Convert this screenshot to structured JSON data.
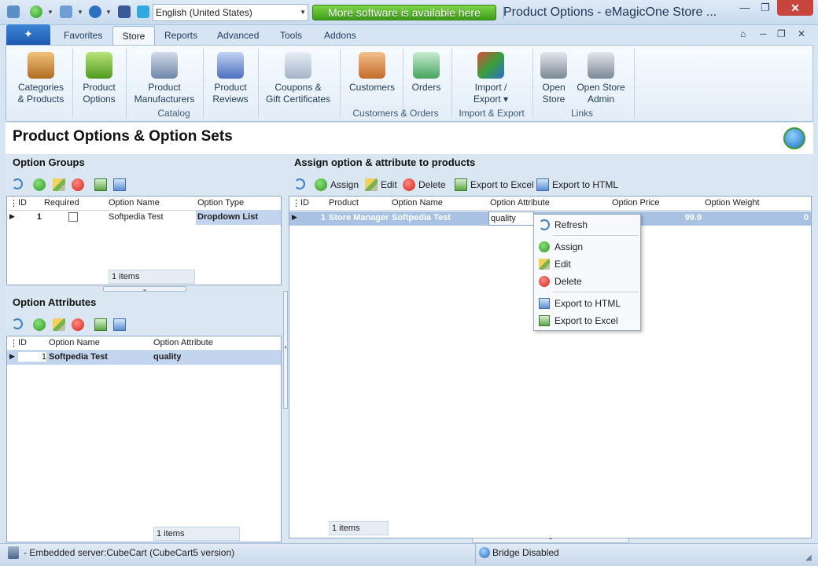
{
  "titlebar": {
    "language": "English (United States)",
    "promo": "More software is available here",
    "window_title": "Product Options - eMagicOne Store ...",
    "min": "—",
    "restore": "❐",
    "close": "✕"
  },
  "tabs": [
    {
      "label": "Favorites"
    },
    {
      "label": "Store"
    },
    {
      "label": "Reports"
    },
    {
      "label": "Advanced"
    },
    {
      "label": "Tools"
    },
    {
      "label": "Addons"
    }
  ],
  "ribbon": {
    "buttons": [
      {
        "label": "Categories\n& Products"
      },
      {
        "label": "Product\nOptions"
      },
      {
        "label": "Product\nManufacturers"
      },
      {
        "label": "Product\nReviews"
      },
      {
        "label": "Coupons &\nGift Certificates"
      },
      {
        "label": "Customers"
      },
      {
        "label": "Orders"
      },
      {
        "label": "Import /\nExport ▾"
      },
      {
        "label": "Open\nStore"
      },
      {
        "label": "Open Store\nAdmin"
      }
    ],
    "groups": [
      "Catalog",
      "Customers & Orders",
      "Import & Export",
      "Links"
    ]
  },
  "page": {
    "title": "Product Options & Option Sets"
  },
  "option_groups": {
    "title": "Option Groups",
    "columns": [
      "ID",
      "Required",
      "Option Name",
      "Option Type"
    ],
    "rows": [
      {
        "id": "1",
        "option_name": "Softpedia Test",
        "option_type": "Dropdown List"
      }
    ],
    "count": "1 items"
  },
  "option_attributes": {
    "title": "Option Attributes",
    "columns": [
      "ID",
      "Option Name",
      "Option Attribute"
    ],
    "rows": [
      {
        "id": "1",
        "option_name": "Softpedia Test",
        "option_attribute": "quality"
      }
    ],
    "count": "1 items"
  },
  "assign": {
    "title": "Assign option & attribute to products",
    "toolbar": {
      "assign": "Assign",
      "edit": "Edit",
      "delete": "Delete",
      "export_excel": "Export to Excel",
      "export_html": "Export to HTML"
    },
    "columns": [
      "ID",
      "Product",
      "Option Name",
      "Option Attribute",
      "Option Price",
      "Option Weight"
    ],
    "rows": [
      {
        "id": "1",
        "product": "Store Manager",
        "option_name": "Softpedia Test",
        "option_attribute": "quality",
        "option_price": "99.9",
        "option_weight": "0"
      }
    ],
    "count": "1 items"
  },
  "context_menu": {
    "items": [
      "Refresh",
      "Assign",
      "Edit",
      "Delete",
      "Export to HTML",
      "Export to Excel"
    ]
  },
  "status": {
    "server": "- Embedded server:CubeCart (CubeCart5 version)",
    "bridge": "Bridge Disabled"
  }
}
